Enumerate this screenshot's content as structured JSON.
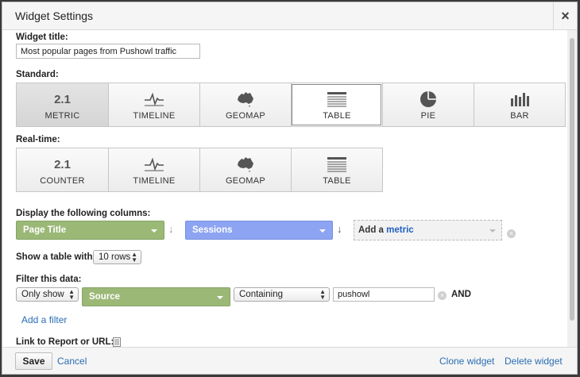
{
  "dialog": {
    "title": "Widget Settings",
    "close_glyph": "×"
  },
  "form": {
    "widget_title_label": "Widget title:",
    "widget_title_value": "Most popular pages from Pushowl traffic",
    "standard_label": "Standard:",
    "realtime_label": "Real-time:",
    "columns_label": "Display the following columns:",
    "show_table_label": "Show a table with",
    "rows_value": "10 rows",
    "filter_label": "Filter this data:",
    "link_label": "Link to Report or URL:"
  },
  "standard_tiles": [
    {
      "name": "METRIC",
      "glyph": "2.1",
      "icon": "metric-icon",
      "selected": "grey"
    },
    {
      "name": "TIMELINE",
      "icon": "timeline-icon"
    },
    {
      "name": "GEOMAP",
      "icon": "geomap-icon"
    },
    {
      "name": "TABLE",
      "icon": "table-icon",
      "selected": "white"
    },
    {
      "name": "PIE",
      "icon": "pie-icon"
    },
    {
      "name": "BAR",
      "icon": "bar-icon"
    }
  ],
  "realtime_tiles": [
    {
      "name": "COUNTER",
      "glyph": "2.1",
      "icon": "counter-icon"
    },
    {
      "name": "TIMELINE",
      "icon": "timeline-icon"
    },
    {
      "name": "GEOMAP",
      "icon": "geomap-icon"
    },
    {
      "name": "TABLE",
      "icon": "table-icon"
    }
  ],
  "columns": {
    "dimension": "Page Title",
    "metric": "Sessions",
    "add_prefix": "Add a",
    "add_metric_word": "metric"
  },
  "filter": {
    "mode": "Only show",
    "dimension": "Source",
    "operator": "Containing",
    "value": "pushowl",
    "and_label": "AND",
    "add_filter_link": "Add a filter"
  },
  "footer": {
    "save_label": "Save",
    "cancel_label": "Cancel",
    "clone_label": "Clone widget",
    "delete_label": "Delete widget"
  },
  "colors": {
    "dimension_pill": "#9bb877",
    "metric_pill": "#8da4f3",
    "link": "#2a6db3"
  }
}
